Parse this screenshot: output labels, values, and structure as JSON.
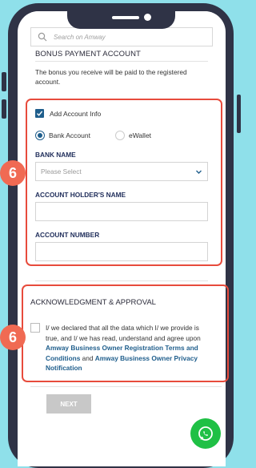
{
  "search": {
    "placeholder": "Search on Amway"
  },
  "section": {
    "title": "BONUS PAYMENT ACCOUNT",
    "description": "The bonus you receive will be paid to the registered account."
  },
  "account_info": {
    "checkbox_label": "Add Account Info",
    "checked": true,
    "options": [
      {
        "label": "Bank Account",
        "selected": true
      },
      {
        "label": "eWallet",
        "selected": false
      }
    ],
    "bank_name": {
      "label": "BANK NAME",
      "placeholder": "Please Select"
    },
    "holder_name": {
      "label": "ACCOUNT HOLDER'S NAME",
      "value": ""
    },
    "account_number": {
      "label": "ACCOUNT NUMBER",
      "value": ""
    }
  },
  "acknowledgment": {
    "title": "ACKNOWLEDGMENT & APPROVAL",
    "text_part1": "I/ we declared that all the data which I/ we provide is true, and I/ we has read, understand and agree upon ",
    "link1": "Amway Business Owner Registration Terms and Conditions",
    "text_part2": " and ",
    "link2": "Amway Business Owner Privacy Notification"
  },
  "buttons": {
    "next": "NEXT"
  },
  "badges": {
    "step1": "6",
    "step2": "6"
  },
  "icons": {
    "search": "search-icon",
    "chevron": "chevron-down-icon",
    "whatsapp": "whatsapp-icon"
  },
  "colors": {
    "accent": "#1f5e8c",
    "highlight": "#e74b3c",
    "badge": "#f06a53",
    "whatsapp": "#1fc045",
    "background": "#8fe0ea"
  }
}
